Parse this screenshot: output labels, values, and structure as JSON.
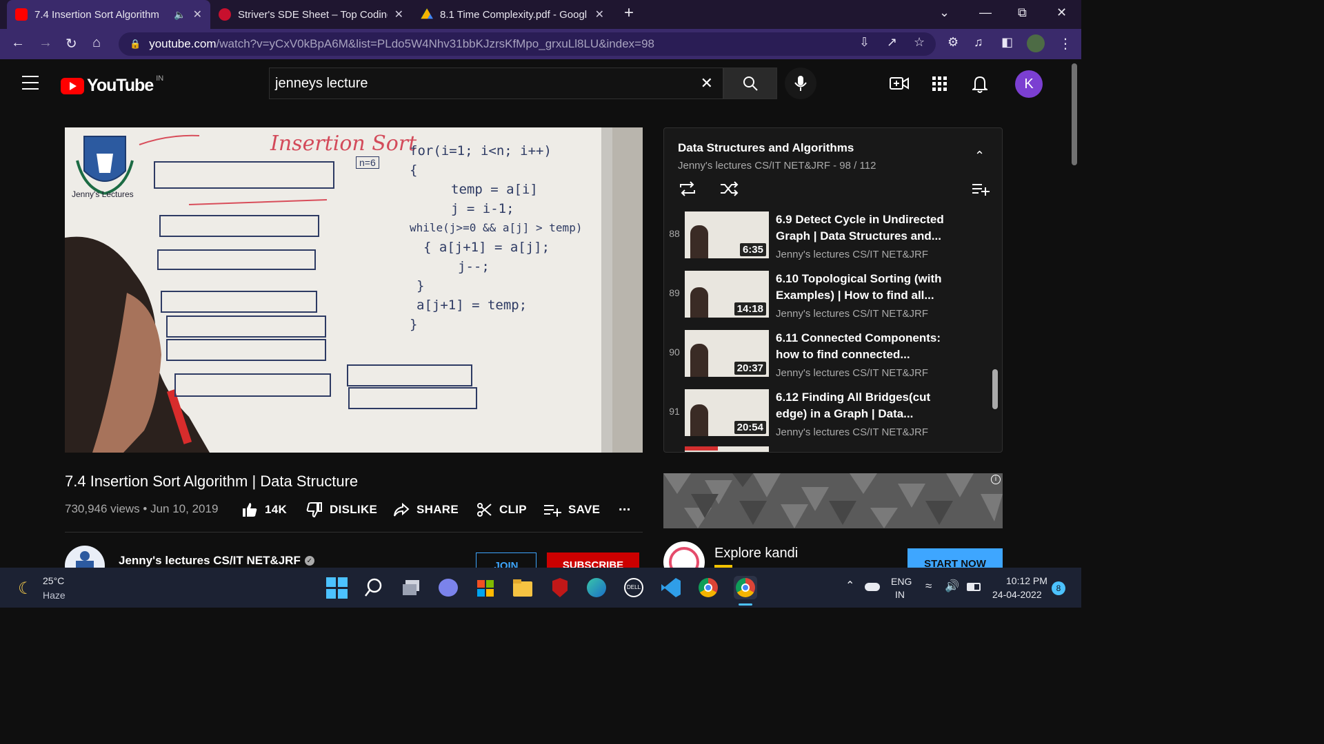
{
  "browser": {
    "tabs": [
      {
        "label": "7.4 Insertion Sort Algorithm",
        "active": true
      },
      {
        "label": "Striver's SDE Sheet – Top Coding",
        "active": false
      },
      {
        "label": "8.1 Time Complexity.pdf - Googl",
        "active": false
      }
    ],
    "new_tab": "+",
    "url_host": "youtube.com",
    "url_path": "/watch?v=yCxV0kBpA6M&list=PLdo5W4Nhv31bbKJzrsKfMpo_grxuLl8LU&index=98"
  },
  "youtube": {
    "logo_text": "YouTube",
    "country": "IN",
    "search_value": "jenneys lecture",
    "avatar_letter": "K"
  },
  "video": {
    "title": "7.4 Insertion Sort Algorithm | Data Structure",
    "views": "730,946 views",
    "date": "Jun 10, 2019",
    "likes": "14K",
    "dislike": "DISLIKE",
    "share": "SHARE",
    "clip": "CLIP",
    "save": "SAVE",
    "more": "...",
    "channel": "Jenny's lectures CS/IT NET&JRF",
    "join": "JOIN",
    "subscribe": "SUBSCRIBE"
  },
  "board": {
    "title": "Insertion Sort",
    "logo_text": "Jenny's Lectures",
    "n": "n=6",
    "code": [
      "for(i=1; i<n; i++)",
      "{",
      "temp = a[i]",
      "j = i-1;",
      "while(j>=0 && a[j] > temp)",
      "{ a[j+1] = a[j];",
      "j--;",
      "}",
      "a[j+1] = temp;",
      "}"
    ]
  },
  "playlist": {
    "title": "Data Structures and Algorithms",
    "subtitle": "Jenny's lectures CS/IT NET&JRF - 98 / 112",
    "items": [
      {
        "index": "88",
        "title": "6.9 Detect Cycle in Undirected Graph | Data Structures and...",
        "channel": "Jenny's lectures CS/IT NET&JRF",
        "duration": "6:35"
      },
      {
        "index": "89",
        "title": "6.10 Topological Sorting (with Examples) | How to find all...",
        "channel": "Jenny's lectures CS/IT NET&JRF",
        "duration": "14:18"
      },
      {
        "index": "90",
        "title": "6.11 Connected Components: how to find connected...",
        "channel": "Jenny's lectures CS/IT NET&JRF",
        "duration": "20:37"
      },
      {
        "index": "91",
        "title": "6.12 Finding All Bridges(cut edge) in a Graph | Data...",
        "channel": "Jenny's lectures CS/IT NET&JRF",
        "duration": "20:54"
      }
    ]
  },
  "ad": {
    "title": "Explore kandi",
    "cta": "START NOW"
  },
  "taskbar": {
    "temp": "25°C",
    "weather": "Haze",
    "lang1": "ENG",
    "lang2": "IN",
    "time": "10:12 PM",
    "date": "24-04-2022",
    "badge": "8"
  }
}
